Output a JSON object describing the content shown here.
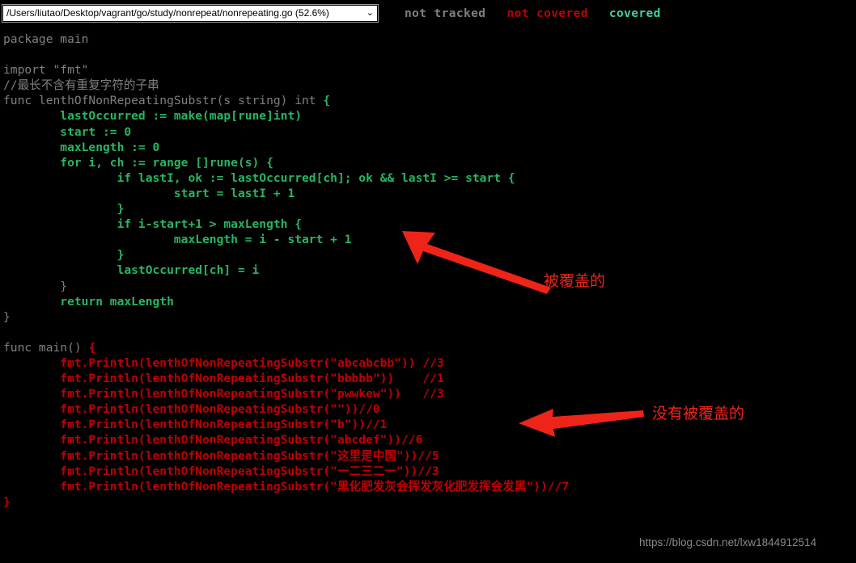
{
  "topbar": {
    "file_select": {
      "value": "/Users/liutao/Desktop/vagrant/go/study/nonrepeat/nonrepeating.go (52.6%)",
      "chevron": "⌄"
    },
    "legend": [
      {
        "label": "not tracked",
        "color": "#808080",
        "key": "not_tracked"
      },
      {
        "label": "not covered",
        "color": "#c40000",
        "key": "not_covered"
      },
      {
        "label": "covered",
        "color": "#44d29a",
        "key": "covered"
      }
    ]
  },
  "code": {
    "language": "go",
    "lines": [
      {
        "segments": [
          {
            "t": "package main",
            "c": "cov0"
          }
        ]
      },
      {
        "segments": [
          {
            "t": "",
            "c": "cov0"
          }
        ]
      },
      {
        "segments": [
          {
            "t": "import \"fmt\"",
            "c": "cov0"
          }
        ]
      },
      {
        "segments": [
          {
            "t": "//最长不含有重复字符的子串",
            "c": "cov0"
          }
        ]
      },
      {
        "segments": [
          {
            "t": "func lenthOfNonRepeatingSubstr(s string) int ",
            "c": "cov0"
          },
          {
            "t": "{",
            "c": "cov8"
          }
        ]
      },
      {
        "segments": [
          {
            "t": "        lastOccurred := make(map[rune]int)",
            "c": "cov8"
          }
        ]
      },
      {
        "segments": [
          {
            "t": "        start := 0",
            "c": "cov8"
          }
        ]
      },
      {
        "segments": [
          {
            "t": "        maxLength := 0",
            "c": "cov8"
          }
        ]
      },
      {
        "segments": [
          {
            "t": "        for i, ch := range []rune(s) {",
            "c": "cov8"
          }
        ]
      },
      {
        "segments": [
          {
            "t": "                if lastI, ok := lastOccurred[ch]; ok && lastI >= start {",
            "c": "cov8"
          }
        ]
      },
      {
        "segments": [
          {
            "t": "                        start = lastI + 1",
            "c": "cov8"
          }
        ]
      },
      {
        "segments": [
          {
            "t": "                }",
            "c": "cov8"
          }
        ]
      },
      {
        "segments": [
          {
            "t": "                if i-start+1 > maxLength {",
            "c": "cov8"
          }
        ]
      },
      {
        "segments": [
          {
            "t": "                        maxLength = i - start + 1",
            "c": "cov8"
          }
        ]
      },
      {
        "segments": [
          {
            "t": "                }",
            "c": "cov8"
          }
        ]
      },
      {
        "segments": [
          {
            "t": "                lastOccurred[ch] = i",
            "c": "cov8"
          }
        ]
      },
      {
        "segments": [
          {
            "t": "        ",
            "c": "cov8"
          },
          {
            "t": "}",
            "c": "cov0"
          }
        ]
      },
      {
        "segments": [
          {
            "t": "        return maxLength",
            "c": "cov8"
          }
        ]
      },
      {
        "segments": [
          {
            "t": "}",
            "c": "cov0"
          }
        ]
      },
      {
        "segments": [
          {
            "t": "",
            "c": "cov0"
          }
        ]
      },
      {
        "segments": [
          {
            "t": "func main() ",
            "c": "cov0"
          },
          {
            "t": "{",
            "c": "cov-no"
          }
        ]
      },
      {
        "segments": [
          {
            "t": "        fmt.Println(lenthOfNonRepeatingSubstr(\"abcabcbb\")) //3",
            "c": "cov-no"
          }
        ]
      },
      {
        "segments": [
          {
            "t": "        fmt.Println(lenthOfNonRepeatingSubstr(\"bbbbb\"))    //1",
            "c": "cov-no"
          }
        ]
      },
      {
        "segments": [
          {
            "t": "        fmt.Println(lenthOfNonRepeatingSubstr(\"pwwkew\"))   //3",
            "c": "cov-no"
          }
        ]
      },
      {
        "segments": [
          {
            "t": "        fmt.Println(lenthOfNonRepeatingSubstr(\"\"))//0",
            "c": "cov-no"
          }
        ]
      },
      {
        "segments": [
          {
            "t": "        fmt.Println(lenthOfNonRepeatingSubstr(\"b\"))//1",
            "c": "cov-no"
          }
        ]
      },
      {
        "segments": [
          {
            "t": "        fmt.Println(lenthOfNonRepeatingSubstr(\"abcdef\"))//6",
            "c": "cov-no"
          }
        ]
      },
      {
        "segments": [
          {
            "t": "        fmt.Println(lenthOfNonRepeatingSubstr(\"这里是中国\"))//5",
            "c": "cov-no"
          }
        ]
      },
      {
        "segments": [
          {
            "t": "        fmt.Println(lenthOfNonRepeatingSubstr(\"一二三二一\"))//3",
            "c": "cov-no"
          }
        ]
      },
      {
        "segments": [
          {
            "t": "        fmt.Println(lenthOfNonRepeatingSubstr(\"黑化肥发灰会挥发灰化肥发挥会发黑\"))//7",
            "c": "cov-no"
          }
        ]
      },
      {
        "segments": [
          {
            "t": "}",
            "c": "cov-no"
          }
        ]
      }
    ]
  },
  "annotations": {
    "color": "#ef2418",
    "covered_label": "被覆盖的",
    "not_covered_label": "没有被覆盖的"
  },
  "watermark": {
    "text": "https://blog.csdn.net/lxw1844912514"
  }
}
